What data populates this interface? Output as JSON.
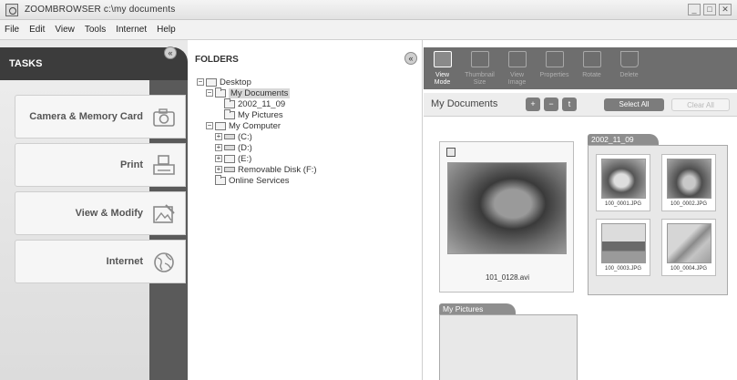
{
  "window": {
    "title": "ZOOMBROWSER c:\\my documents",
    "controls": [
      "_",
      "□",
      "✕"
    ]
  },
  "menu": [
    "File",
    "Edit",
    "View",
    "Tools",
    "Internet",
    "Help"
  ],
  "tasks": {
    "title": "TASKS",
    "collapse_glyph": "«",
    "buttons": [
      {
        "label": "Camera & Memory Card",
        "icon": "camera-icon"
      },
      {
        "label": "Print",
        "icon": "printer-icon"
      },
      {
        "label": "View & Modify",
        "icon": "view-modify-icon"
      },
      {
        "label": "Internet",
        "icon": "globe-icon"
      }
    ]
  },
  "folders": {
    "title": "FOLDERS",
    "collapse_glyph": "«",
    "tree": [
      {
        "label": "Desktop",
        "toggle": "−"
      },
      {
        "label": "My Documents",
        "toggle": "−",
        "selected": true
      },
      {
        "label": "2002_11_09",
        "toggle": ""
      },
      {
        "label": "My Pictures",
        "toggle": ""
      },
      {
        "label": "My Computer",
        "toggle": "−"
      },
      {
        "label": "(C:)",
        "toggle": "+"
      },
      {
        "label": "(D:)",
        "toggle": "+"
      },
      {
        "label": "(E:)",
        "toggle": "+"
      },
      {
        "label": "Removable Disk (F:)",
        "toggle": "+"
      },
      {
        "label": "Online Services",
        "toggle": ""
      }
    ]
  },
  "toolbar": {
    "tools": [
      {
        "label": "View\nMode",
        "active": true
      },
      {
        "label": "Thumbnail\nSize",
        "active": false
      },
      {
        "label": "View\nImage",
        "active": false
      },
      {
        "label": "Properties",
        "active": false
      },
      {
        "label": "Rotate",
        "active": false
      },
      {
        "label": "Delete",
        "active": false
      }
    ]
  },
  "subbar": {
    "location": "My Documents",
    "zoom_in": "+",
    "zoom_out": "−",
    "up": "t",
    "select_all": "Select All",
    "clear_all": "Clear All"
  },
  "browse": {
    "video": {
      "filename": "101_0128.avi"
    },
    "group1": {
      "name": "2002_11_09",
      "images": [
        "100_0001.JPG",
        "100_0002.JPG",
        "100_0003.JPG",
        "100_0004.JPG"
      ]
    },
    "group2": {
      "name": "My Pictures"
    }
  }
}
